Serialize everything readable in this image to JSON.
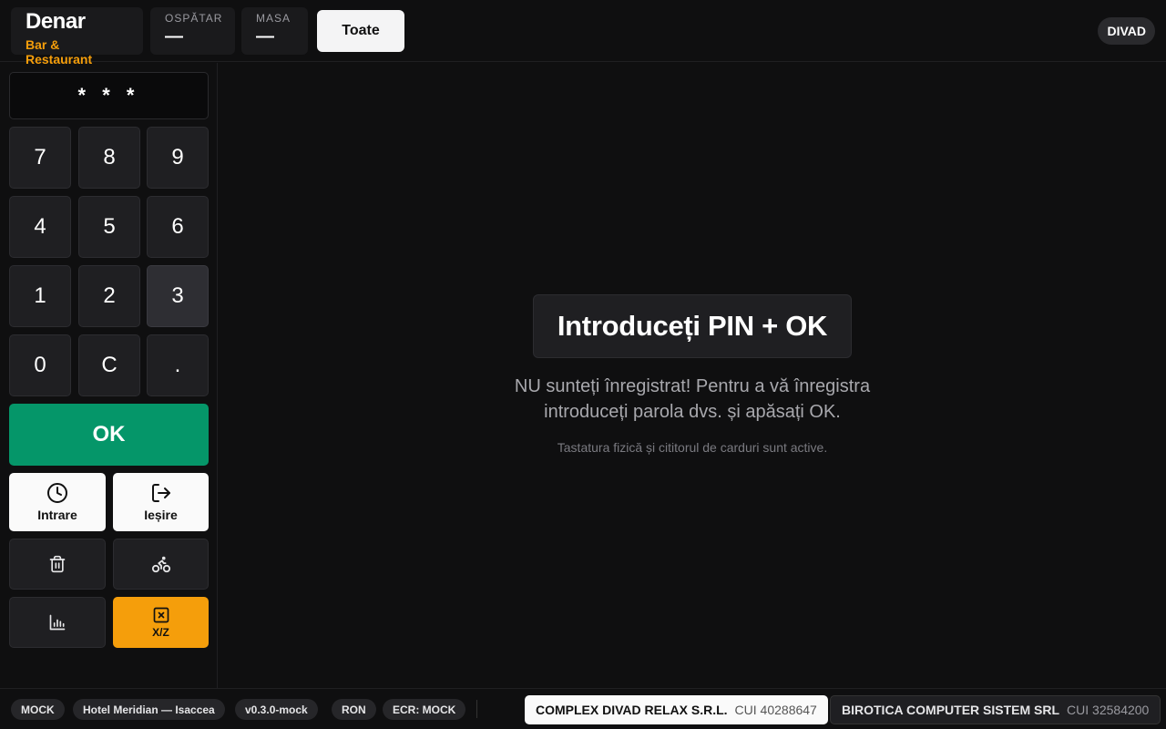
{
  "header": {
    "brand_name": "Denar",
    "brand_sub": "Bar & Restaurant",
    "waiter_label": "OSPĂTAR",
    "waiter_value": "—",
    "table_label": "MASA",
    "table_value": "—",
    "all_button": "Toate",
    "user": "DIVAD"
  },
  "keypad": {
    "display": "* * *",
    "keys": [
      "7",
      "8",
      "9",
      "4",
      "5",
      "6",
      "1",
      "2",
      "3",
      "0",
      "C",
      "."
    ],
    "ok": "OK",
    "entry_label": "Intrare",
    "exit_label": "Ieșire",
    "xz_label": "X/Z"
  },
  "main": {
    "title": "Introduceți PIN + OK",
    "message_line1": "NU sunteți înregistrat! Pentru a vă înregistra",
    "message_line2": "introduceți parola dvs. și apăsați OK.",
    "hint": "Tastatura fizică și cititorul de carduri sunt active."
  },
  "footer": {
    "mode": "MOCK",
    "location": "Hotel Meridian — Isaccea",
    "version": "v0.3.0-mock",
    "currency": "RON",
    "ecr": "ECR: MOCK",
    "company1_name": "COMPLEX DIVAD RELAX S.R.L.",
    "company1_cui": "CUI 40288647",
    "company2_name": "BIROTICA COMPUTER SISTEM SRL",
    "company2_cui": "CUI 32584200"
  },
  "colors": {
    "ok": "#059669",
    "accent": "#f59e0b",
    "background": "#0f0f10"
  }
}
